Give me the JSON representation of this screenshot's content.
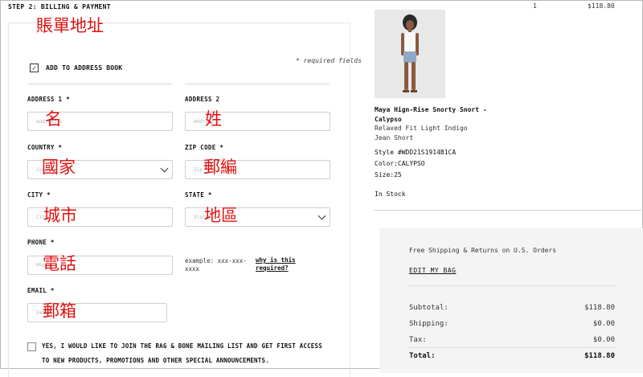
{
  "step_title": "STEP 2: BILLING & PAYMENT",
  "annotations": {
    "billing_address": "賬單地址",
    "first_name": "名",
    "last_name": "姓",
    "country": "國家",
    "postal_code": "郵編",
    "city": "城市",
    "region": "地區",
    "phone": "電話",
    "email": "郵箱"
  },
  "form": {
    "add_to_address_book": "ADD TO ADDRESS BOOK",
    "required_fields": "* required fields",
    "address1_label": "ADDRESS 1 *",
    "address1_placeholder": "Address 1",
    "address2_label": "ADDRESS 2",
    "address2_placeholder": "Address 2",
    "country_label": "COUNTRY *",
    "country_value": "Country",
    "zip_label": "ZIP CODE *",
    "zip_placeholder": "Zip Code",
    "city_label": "CITY *",
    "city_placeholder": "City",
    "state_label": "STATE *",
    "state_value": "State",
    "phone_label": "PHONE *",
    "phone_placeholder": "Phone",
    "phone_hint": "example: xxx-xxx-xxxx",
    "phone_why": "why is this required?",
    "email_label": "EMAIL *",
    "email_placeholder": "Email",
    "mailing_optin": "YES, I WOULD LIKE TO JOIN THE RAG & BONE MAILING LIST AND GET FIRST ACCESS TO NEW PRODUCTS, PROMOTIONS AND OTHER SPECIAL ANNOUNCEMENTS."
  },
  "cart": {
    "quantity": "1",
    "price": "$118.80",
    "product_name": "Maya Hign-Rise Snorty Snort - Calypso",
    "product_desc": "Relaxed Fit Light Indigo Jean Short",
    "style": "Style #WDD21S1914B1CA",
    "color": "Color:CALYPSO",
    "size": "Size:25",
    "stock": "In Stock"
  },
  "summary": {
    "shipping_note": "Free Shipping & Returns on U.S. Orders",
    "edit_bag": "EDIT MY BAG",
    "rows": [
      {
        "label": "Subtotal:",
        "value": "$118.80"
      },
      {
        "label": "Shipping:",
        "value": "$0.00"
      },
      {
        "label": "Tax:",
        "value": "$0.00"
      },
      {
        "label": "Total:",
        "value": "$118.80"
      }
    ]
  },
  "colors": {
    "annotation": "#e01010",
    "summary_bg": "#f4f4f4"
  }
}
